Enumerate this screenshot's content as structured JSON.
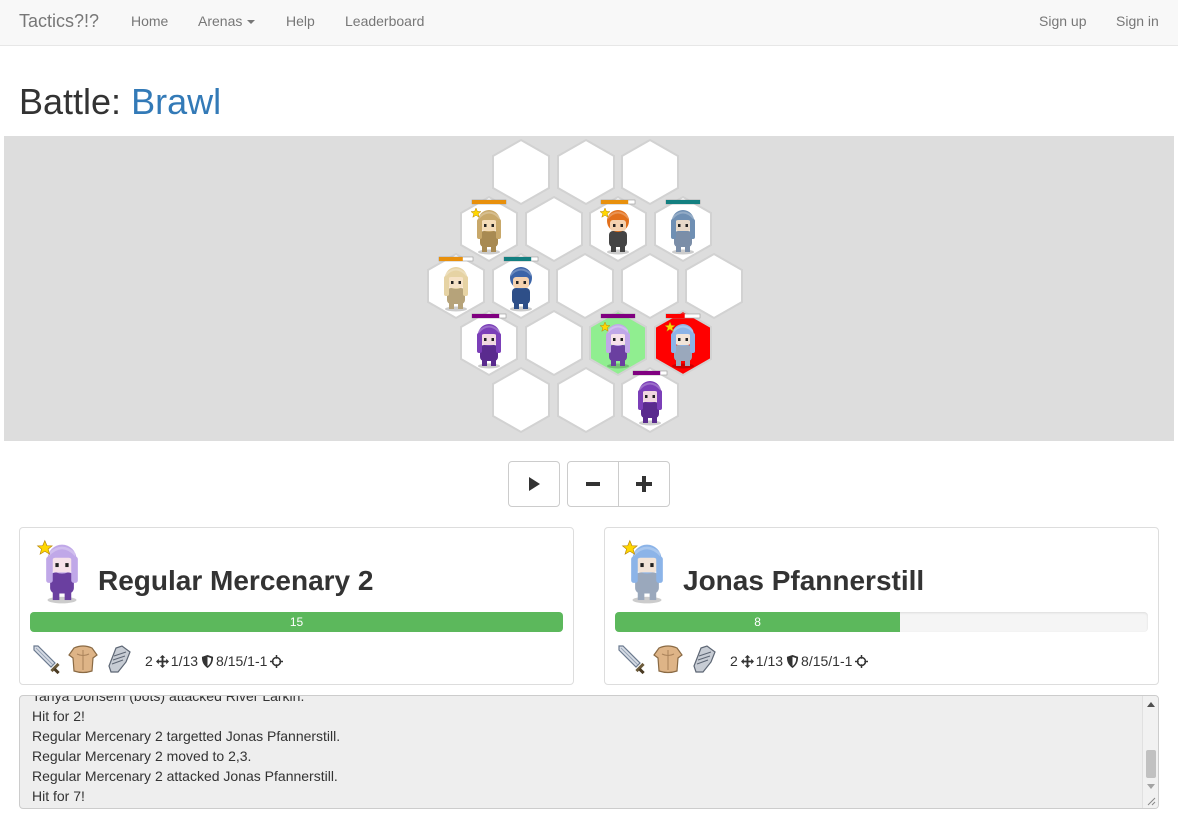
{
  "nav": {
    "brand": "Tactics?!?",
    "home": "Home",
    "arenas": "Arenas",
    "help": "Help",
    "leaderboard": "Leaderboard",
    "signup": "Sign up",
    "signin": "Sign in"
  },
  "page": {
    "title_prefix": "Battle: ",
    "arena_name": "Brawl"
  },
  "board": {
    "colors": {
      "empty": "#ffffff",
      "active": "#90ee90",
      "target": "#ff0000",
      "team_orange": "#e8900c",
      "team_teal": "#137f80",
      "team_purple": "#800080",
      "team_red": "#ff0000"
    }
  },
  "controls": {
    "play": "play-icon",
    "zoom_out": "minus-icon",
    "zoom_in": "plus-icon"
  },
  "left_unit": {
    "name": "Regular Mercenary 2",
    "hp_value": 15,
    "hp_fraction": 1.0,
    "hp_text": "15",
    "stat_move": "2",
    "stat_attack": "1/13",
    "stat_defense": "8/15/1-1",
    "equipment": [
      "sword-icon",
      "leather-armor-icon",
      "gauntlet-icon"
    ]
  },
  "right_unit": {
    "name": "Jonas Pfannerstill",
    "hp_value": 8,
    "hp_fraction": 0.535,
    "hp_text": "8",
    "stat_move": "2",
    "stat_attack": "1/13",
    "stat_defense": "8/15/1-1",
    "equipment": [
      "sword-icon",
      "leather-armor-icon",
      "gauntlet-icon"
    ]
  },
  "log": {
    "lines": [
      "Tanya Donsem (bots) attacked River Larkin.",
      "Hit for 2!",
      "Regular Mercenary 2 targetted Jonas Pfannerstill.",
      "Regular Mercenary 2 moved to 2,3.",
      "Regular Mercenary 2 attacked Jonas Pfannerstill.",
      "Hit for 7!"
    ]
  }
}
